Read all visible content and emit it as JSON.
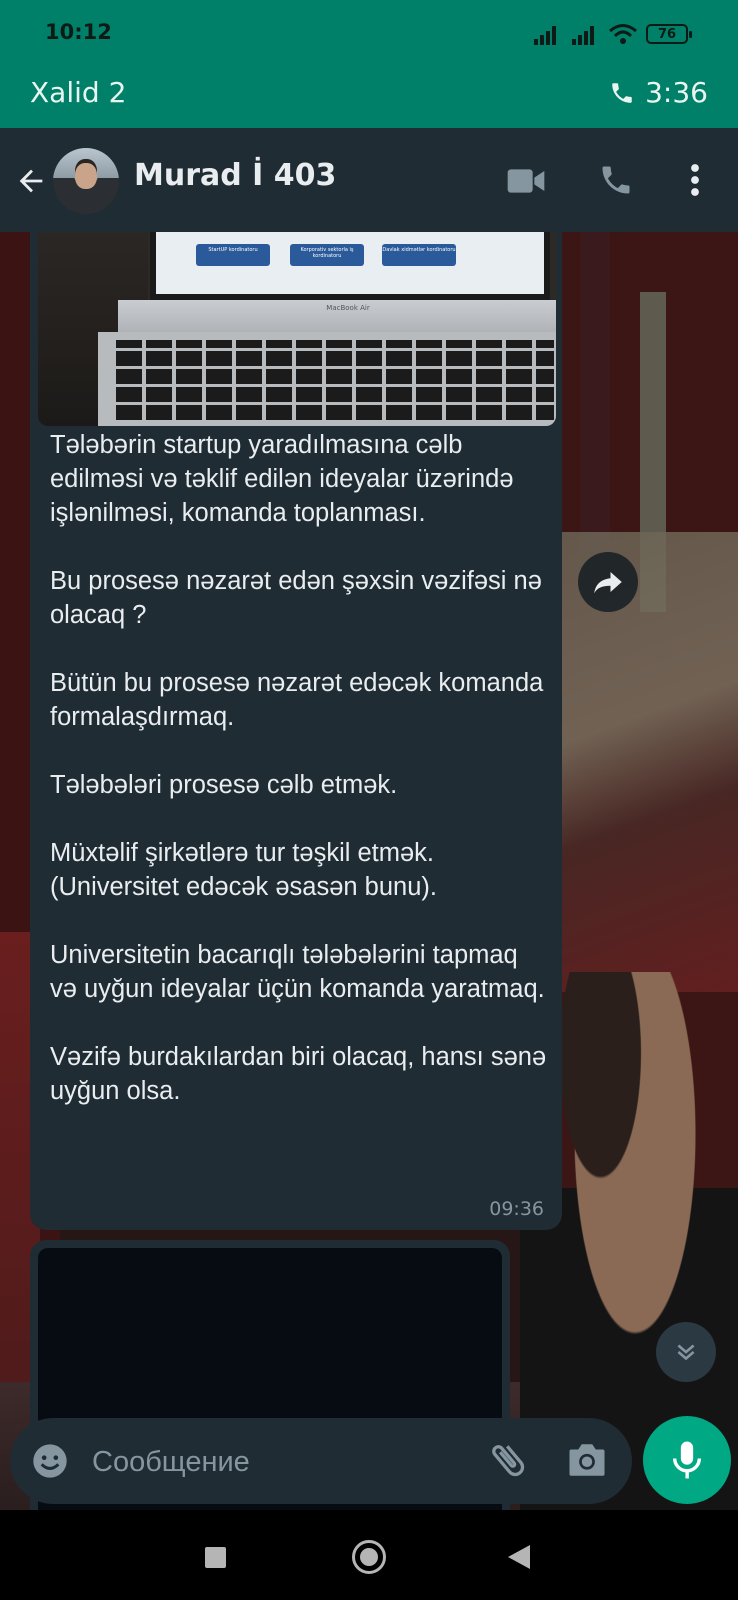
{
  "status_bar": {
    "time": "10:12",
    "battery": "76"
  },
  "call_banner": {
    "name": "Xalid 2",
    "duration": "3:36"
  },
  "header": {
    "contact_name": "Murad İ 403"
  },
  "message": {
    "image_buttons": [
      "StartUP kordinatoru",
      "Korporativ sektorla iş kordinatoru",
      "Davlak xidmətlər kordinatoru"
    ],
    "image_brand": "MacBook Air",
    "text": "Tələbərin startup yaradılmasına cəlb edilməsi və təklif edilən ideyalar üzərində işlənilməsi, komanda toplanması.\n\nBu prosesə nəzarət edən şəxsin vəzifəsi nə olacaq ?\n\nBütün bu prosesə nəzarət edəcək komanda formalaşdırmaq.\n\nTələbələri prosesə cəlb etmək.\n\nMüxtəlif şirkətlərə tur təşkil etmək. (Universitet edəcək əsasən bunu).\n\nUniversitetin bacarıqlı tələbələrini tapmaq və uyğun ideyalar üçün komanda yaratmaq.\n\nVəzifə burdakılardan biri olacaq, hansı sənə uyğun olsa.",
    "time": "09:36"
  },
  "composer": {
    "placeholder": "Сообщение"
  },
  "colors": {
    "brand_green": "#008069",
    "mic_green": "#00a884",
    "bubble_bg": "#1f2c33",
    "text": "#e9edef",
    "muted": "#8696a0"
  },
  "icons": [
    "back-arrow-icon",
    "video-call-icon",
    "phone-icon",
    "more-vert-icon",
    "forward-icon",
    "chevron-double-down-icon",
    "emoji-icon",
    "attach-icon",
    "camera-icon",
    "mic-icon"
  ]
}
